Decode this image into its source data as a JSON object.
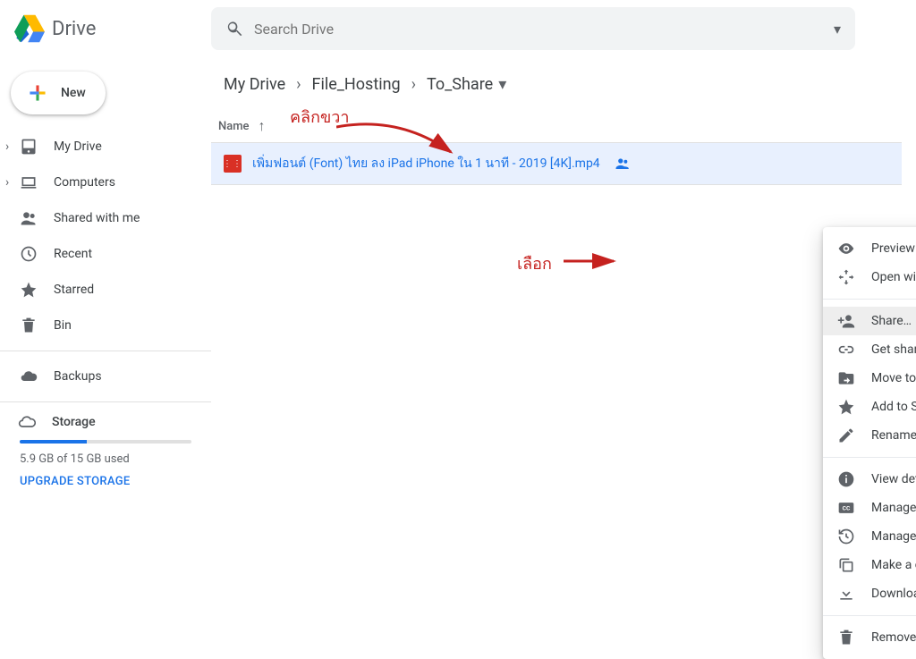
{
  "app": {
    "name": "Drive",
    "search_placeholder": "Search Drive"
  },
  "sidebar": {
    "new_label": "New",
    "items": [
      {
        "label": "My Drive"
      },
      {
        "label": "Computers"
      },
      {
        "label": "Shared with me"
      },
      {
        "label": "Recent"
      },
      {
        "label": "Starred"
      },
      {
        "label": "Bin"
      }
    ],
    "backups_label": "Backups",
    "storage": {
      "label": "Storage",
      "percent": 39,
      "text": "5.9 GB of 15 GB used",
      "upgrade": "UPGRADE STORAGE"
    }
  },
  "breadcrumbs": [
    "My Drive",
    "File_Hosting",
    "To_Share"
  ],
  "list": {
    "name_col": "Name"
  },
  "file": {
    "name": "เพิ่มฟอนต์ (Font) ไทย ลง iPad iPhone ใน 1 นาที - 2019 [4K].mp4"
  },
  "menu": {
    "preview": "Preview",
    "open_with": "Open with",
    "share": "Share…",
    "get_link": "Get shareable link",
    "move_to": "Move to…",
    "star": "Add to Starred",
    "rename": "Rename…",
    "view_details": "View details",
    "captions": "Manage caption tracks…",
    "versions": "Manage versions…",
    "copy": "Make a copy",
    "download": "Download",
    "remove": "Remove"
  },
  "annotations": {
    "right_click": "คลิกขวา",
    "choose": "เลือก"
  }
}
